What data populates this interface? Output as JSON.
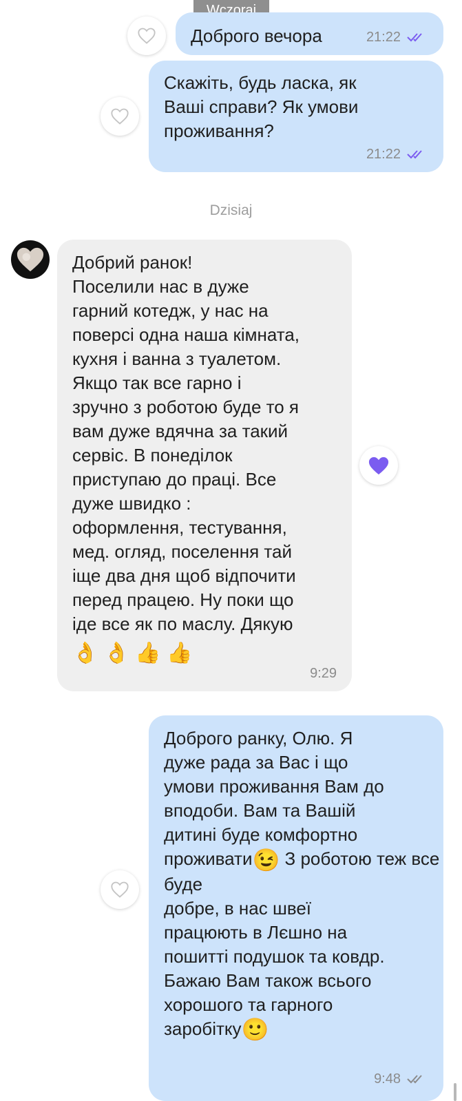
{
  "date_labels": {
    "yesterday": "Wczoraj",
    "today": "Dzisiaj"
  },
  "messages": [
    {
      "direction": "outgoing",
      "text": "Доброго вечора",
      "time": "21:22",
      "status": "read-double-tick",
      "reaction": "heart-outline-icon"
    },
    {
      "direction": "outgoing",
      "text": "Скажіть, будь ласка, як\nВаші справи? Як умови\nпроживання?",
      "time": "21:22",
      "status": "read-double-tick",
      "reaction": "heart-outline-icon"
    },
    {
      "direction": "incoming",
      "text": "Добрий ранок!\nПоселили нас в дуже\nгарний котедж, у нас на\nповерсі одна наша кімната,\nкухня і ванна з туалетом.\nЯкщо  так все гарно і\nзручно з роботою буде то я\nвам дуже вдячна за такий\nсервіс. В понеділок\nприступаю до праці. Все\nдуже швидко :\nоформлення,  тестування,\nмед. огляд, поселення тай\nіще два дня щоб відпочити\nперед працею. Ну поки що\nіде все як по маслу. Дякую",
      "emojis": [
        "👌",
        "👌",
        "👍",
        "👍"
      ],
      "time": "9:29",
      "reaction": "heart-filled-icon"
    },
    {
      "direction": "outgoing",
      "part1": "Доброго ранку, Олю. Я\nдуже рада за Вас і що\nумови проживання Вам до\nвподоби. Вам та Вашій\nдитині буде комфортно\nпроживати",
      "part2": "З роботою теж все буде\nдобре, в нас швеї\nпрацюють в Лєшно на\nпошитті подушок та ковдр.\nБажаю Вам також всього\nхорошого та гарного\nзаробітку",
      "emoji_wink": "😉",
      "emoji_smile": "🙂",
      "time": "9:48",
      "status": "sent-double-tick",
      "reaction": "heart-outline-icon"
    }
  ],
  "colors": {
    "outgoing_bubble": "#cde3fb",
    "incoming_bubble": "#efefef",
    "accent_purple": "#7b5cf0",
    "date_pill": "#8f8f8f"
  }
}
